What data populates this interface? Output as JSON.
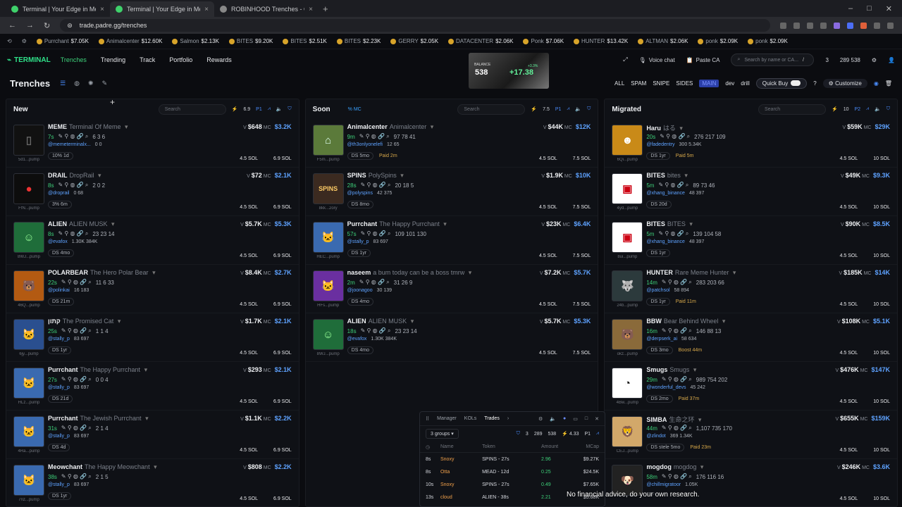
{
  "browser": {
    "tabs": [
      {
        "title": "Terminal | Your Edge in Memec"
      },
      {
        "title": "Terminal | Your Edge in Memec"
      },
      {
        "title": "ROBINHOOD Trenches - Gi"
      }
    ],
    "url": "trade.padre.gg/trenches"
  },
  "ticker": [
    {
      "name": "Purrchant",
      "val": "$7.05K"
    },
    {
      "name": "Animalcenter",
      "val": "$12.60K"
    },
    {
      "name": "Salmon",
      "val": "$2.13K"
    },
    {
      "name": "BITES",
      "val": "$9.20K"
    },
    {
      "name": "BITES",
      "val": "$2.51K"
    },
    {
      "name": "BITES",
      "val": "$2.23K"
    },
    {
      "name": "GERRY",
      "val": "$2.05K"
    },
    {
      "name": "DATACENTER",
      "val": "$2.06K"
    },
    {
      "name": "Ponk",
      "val": "$7.06K"
    },
    {
      "name": "HUNTER",
      "val": "$13.42K"
    },
    {
      "name": "ALTMAN",
      "val": "$2.06K"
    },
    {
      "name": "ponk",
      "val": "$2.09K"
    },
    {
      "name": "ponk",
      "val": "$2.09K"
    }
  ],
  "nav": {
    "logo": "TERMINAL",
    "links": [
      "Trenches",
      "Trending",
      "Track",
      "Portfolio",
      "Rewards"
    ],
    "voice": "Voice chat",
    "paste": "Paste CA",
    "search_placeholder": "Search by name or CA...",
    "slash": "/",
    "n1": "3",
    "n2": "289",
    "n3": "538"
  },
  "balance": {
    "label": "BALANCE",
    "value": "538",
    "change": "+17.38",
    "small": "+3.3%"
  },
  "page": {
    "title": "Trenches",
    "filters": [
      "ALL",
      "SPAM",
      "SNIPE",
      "SIDES",
      "MAIN",
      "dev",
      "drill"
    ],
    "quick_buy": "Quick Buy",
    "customize": "Customize"
  },
  "columns": [
    {
      "title": "New",
      "search": "Search",
      "extra": "",
      "num": "6.9",
      "p": "P1",
      "cards": [
        {
          "name": "MEME",
          "full": "Terminal Of Meme",
          "age": "7s",
          "stats": "6   3   6",
          "handle": "@memeterminalx...",
          "hs": "0   0",
          "tag": "10%  1d",
          "paid": "",
          "v": "$648",
          "mc": "$3.2K",
          "sol": "4.5 SOL",
          "solp": "6.9 SOL",
          "pd": "5d1...pump",
          "glyph": "▯",
          "bg": "#111",
          "fg": "#666"
        },
        {
          "name": "DRAIL",
          "full": "DropRail",
          "age": "8s",
          "stats": "2   0   2",
          "handle": "@droprail",
          "hs": "0   68",
          "tag": "3%  6m",
          "paid": "",
          "v": "$72",
          "mc": "$2.1K",
          "sol": "4.5 SOL",
          "solp": "6.9 SOL",
          "pd": "FfN...pump",
          "glyph": "●",
          "bg": "#0d0d0d",
          "fg": "#e33"
        },
        {
          "name": "ALIEN",
          "full": "ALIEN MUSK",
          "age": "8s",
          "stats": "23   23   14",
          "handle": "@evafox",
          "hs": "1.30K   384K",
          "tag": "DS  4mo",
          "paid": "",
          "v": "$5.7K",
          "mc": "$5.3K",
          "sol": "4.5 SOL",
          "solp": "6.9 SOL",
          "pd": "8WJ...pump",
          "glyph": "☺",
          "bg": "#1f6d3a",
          "fg": "#9f9"
        },
        {
          "name": "POLARBEAR",
          "full": "The Hero Polar Bear",
          "age": "22s",
          "stats": "11   6   33",
          "handle": "@polinkai",
          "hs": "16   183",
          "tag": "DS  21m",
          "paid": "",
          "v": "$8.4K",
          "mc": "$2.7K",
          "sol": "4.5 SOL",
          "solp": "6.9 SOL",
          "pd": "46Q...pump",
          "glyph": "🐻",
          "bg": "#b35a12",
          "fg": "#ffd"
        },
        {
          "name": "קתון",
          "full": "The Promised Cat",
          "age": "25s",
          "stats": "1   1   4",
          "handle": "@stally_p",
          "hs": "83   697",
          "tag": "DS  1yr",
          "paid": "",
          "v": "$1.7K",
          "mc": "$2.1K",
          "sol": "4.5 SOL",
          "solp": "6.9 SOL",
          "pd": "6jy...pump",
          "glyph": "🐱",
          "bg": "#2a4f8f",
          "fg": "#fff"
        },
        {
          "name": "Purrchant",
          "full": "The Happy Purrchant",
          "age": "27s",
          "stats": "0   0   4",
          "handle": "@stally_p",
          "hs": "83   697",
          "tag": "DS  21d",
          "paid": "",
          "v": "$293",
          "mc": "$2.1K",
          "sol": "4.5 SOL",
          "solp": "6.9 SOL",
          "pd": "HLz...pump",
          "glyph": "🐱",
          "bg": "#3a6ab0",
          "fg": "#fff"
        },
        {
          "name": "Purrchant",
          "full": "The Jewish Purrchant",
          "age": "31s",
          "stats": "2   1   4",
          "handle": "@stally_p",
          "hs": "83   697",
          "tag": "DS  4d",
          "paid": "",
          "v": "$1.1K",
          "mc": "$2.2K",
          "sol": "4.5 SOL",
          "solp": "6.9 SOL",
          "pd": "4Ra...pump",
          "glyph": "🐱",
          "bg": "#3a6ab0",
          "fg": "#fff"
        },
        {
          "name": "Meowchant",
          "full": "The Happy Meowchant",
          "age": "38s",
          "stats": "2   1   5",
          "handle": "@stally_p",
          "hs": "83   697",
          "tag": "DS  1yr",
          "paid": "",
          "v": "$808",
          "mc": "$2.2K",
          "sol": "4.5 SOL",
          "solp": "6.9 SOL",
          "pd": "7nz...pump",
          "glyph": "🐱",
          "bg": "#3a6ab0",
          "fg": "#fff"
        }
      ]
    },
    {
      "title": "Soon",
      "search": "Search",
      "extra": "%   MC",
      "num": "7.5",
      "p": "P1",
      "cards": [
        {
          "name": "Animalcenter",
          "full": "Animalcenter",
          "age": "9m",
          "stats": "97   78   41",
          "handle": "@th3onlyonelefi",
          "hs": "12   65",
          "tag": "DS  5mo",
          "paid": "Paid 2m",
          "v": "$44K",
          "mc": "$12K",
          "sol": "4.5 SOL",
          "solp": "7.5 SOL",
          "pd": "F5m...pump",
          "glyph": "⌂",
          "bg": "#5b7a3a",
          "fg": "#dfe"
        },
        {
          "name": "SPINS",
          "full": "PolySpins",
          "age": "28s",
          "stats": "20   18   5",
          "handle": "@polyspins",
          "hs": "42   375",
          "tag": "DS  8mo",
          "paid": "",
          "v": "$1.9K",
          "mc": "$10K",
          "sol": "4.5 SOL",
          "solp": "7.5 SOL",
          "pd": "8kk...2ory",
          "glyph": "SPINS",
          "bg": "#3b2a20",
          "fg": "#fc6"
        },
        {
          "name": "Purrchant",
          "full": "The Happy Purrchant",
          "age": "57s",
          "stats": "109   101   130",
          "handle": "@stally_p",
          "hs": "83   697",
          "tag": "DS  1yr",
          "paid": "",
          "v": "$23K",
          "mc": "$6.4K",
          "sol": "4.5 SOL",
          "solp": "7.5 SOL",
          "pd": "HEC...pump",
          "glyph": "🐱",
          "bg": "#3a6ab0",
          "fg": "#fff"
        },
        {
          "name": "naseem",
          "full": "a bum today can be a boss tmrw",
          "age": "2m",
          "stats": "31   26   9",
          "handle": "@joonagoo",
          "hs": "30   139",
          "tag": "DS  4mo",
          "paid": "",
          "v": "$7.2K",
          "mc": "$5.7K",
          "sol": "4.5 SOL",
          "solp": "7.5 SOL",
          "pd": "HFs...pump",
          "glyph": "🐱",
          "bg": "#6a2fa0",
          "fg": "#fff"
        },
        {
          "name": "ALIEN",
          "full": "ALIEN MUSK",
          "age": "18s",
          "stats": "23   23   14",
          "handle": "@evafox",
          "hs": "1.30K   384K",
          "tag": "DS  4mo",
          "paid": "",
          "v": "$5.7K",
          "mc": "$5.3K",
          "sol": "4.5 SOL",
          "solp": "7.5 SOL",
          "pd": "8WJ...pump",
          "glyph": "☺",
          "bg": "#1f6d3a",
          "fg": "#9f9"
        }
      ]
    },
    {
      "title": "Migrated",
      "search": "Search",
      "extra": "",
      "num": "10",
      "p": "P2",
      "cards": [
        {
          "name": "Haru",
          "full": "はる",
          "age": "20s",
          "stats": "276   217   109",
          "handle": "@fadedentry",
          "hs": "300   5.34K",
          "tag": "DS  1yr",
          "paid": "Paid 5m",
          "v": "$59K",
          "mc": "$29K",
          "sol": "4.5 SOL",
          "solp": "10 SOL",
          "pd": "6Qi...pump",
          "glyph": "☻",
          "bg": "#c98a18",
          "fg": "#fff"
        },
        {
          "name": "BITES",
          "full": "bites",
          "age": "5m",
          "stats": "89   73   46",
          "handle": "@xhang_binance",
          "hs": "48   397",
          "tag": "DS  20d",
          "paid": "",
          "v": "$49K",
          "mc": "$9.3K",
          "sol": "4.5 SOL",
          "solp": "10 SOL",
          "pd": "4yd...pump",
          "glyph": "▣",
          "bg": "#ffffff",
          "fg": "#c01"
        },
        {
          "name": "BITES",
          "full": "BITES",
          "age": "5m",
          "stats": "139   104   58",
          "handle": "@xhang_binance",
          "hs": "48   397",
          "tag": "DS  1yr",
          "paid": "",
          "v": "$90K",
          "mc": "$8.5K",
          "sol": "4.5 SOL",
          "solp": "10 SOL",
          "pd": "8ui...pump",
          "glyph": "▣",
          "bg": "#ffffff",
          "fg": "#c01"
        },
        {
          "name": "HUNTER",
          "full": "Rare Meme Hunter",
          "age": "14m",
          "stats": "283   203   66",
          "handle": "@patchsol",
          "hs": "58   894",
          "tag": "DS  1yr",
          "paid": "Paid 11m",
          "v": "$185K",
          "mc": "$14K",
          "sol": "4.5 SOL",
          "solp": "10 SOL",
          "pd": "24b...pump",
          "glyph": "🐺",
          "bg": "#2c3a3c",
          "fg": "#ccc"
        },
        {
          "name": "BBW",
          "full": "Bear Behind Wheel",
          "age": "16m",
          "stats": "146   88   13",
          "handle": "@derpserk_ai",
          "hs": "58   634",
          "tag": "DS  3mo",
          "paid": "Boost 44m",
          "v": "$108K",
          "mc": "$5.1K",
          "sol": "4.5 SOL",
          "solp": "10 SOL",
          "pd": "okz...pump",
          "glyph": "🐻",
          "bg": "#8a6a3a",
          "fg": "#fff"
        },
        {
          "name": "Smugs",
          "full": "Smugs",
          "age": "29m",
          "stats": "989   754   202",
          "handle": "@wonderful_devs",
          "hs": "45   242",
          "tag": "DS  2mo",
          "paid": "Paid 37m",
          "v": "$476K",
          "mc": "$147K",
          "sol": "4.5 SOL",
          "solp": "10 SOL",
          "pd": "4Bw...pump",
          "glyph": "◔",
          "bg": "#ffffff",
          "fg": "#111"
        },
        {
          "name": "SIMBA",
          "full": "生命之环",
          "age": "44m",
          "stats": "1,107   735   170",
          "handle": "@zlindot",
          "hs": "369   1.34K",
          "tag": "DS  stele  5mo",
          "paid": "Paid 23m",
          "v": "$655K",
          "mc": "$159K",
          "sol": "4.5 SOL",
          "solp": "10 SOL",
          "pd": "CEJ...pump",
          "glyph": "🦁",
          "bg": "#d2a86a",
          "fg": "#fff"
        },
        {
          "name": "mogdog",
          "full": "mogdog",
          "age": "58m",
          "stats": "176   116   16",
          "handle": "@chillmigratoor",
          "hs": "1.05K",
          "tag": "",
          "paid": "",
          "v": "$246K",
          "mc": "$3.6K",
          "sol": "4.5 SOL",
          "solp": "10 SOL",
          "pd": "",
          "glyph": "🐶",
          "bg": "#222",
          "fg": "#ddd"
        }
      ]
    }
  ],
  "trades_panel": {
    "tabs": [
      "Manager",
      "KOLs",
      "Trades"
    ],
    "groups": "3 groups",
    "n1": "3",
    "n2": "289",
    "n3": "538",
    "n4": "4.33",
    "p": "P1",
    "headers": [
      "Name",
      "Token",
      "Amount",
      "MCap"
    ],
    "rows": [
      {
        "t": "8s",
        "name": "Snoxy",
        "token": "SPINS - 27s",
        "amt": "2.96",
        "mcap": "$9.27K"
      },
      {
        "t": "8s",
        "name": "Otta",
        "token": "MEAD - 12d",
        "amt": "0.25",
        "mcap": "$24.5K"
      },
      {
        "t": "10s",
        "name": "Snoxy",
        "token": "SPINS - 27s",
        "amt": "0.49",
        "mcap": "$7.65K"
      },
      {
        "t": "13s",
        "name": "cloud",
        "token": "ALIEN - 38s",
        "amt": "2.21",
        "mcap": "$5.68K"
      }
    ]
  },
  "caption": "No financial advice, do your own research."
}
